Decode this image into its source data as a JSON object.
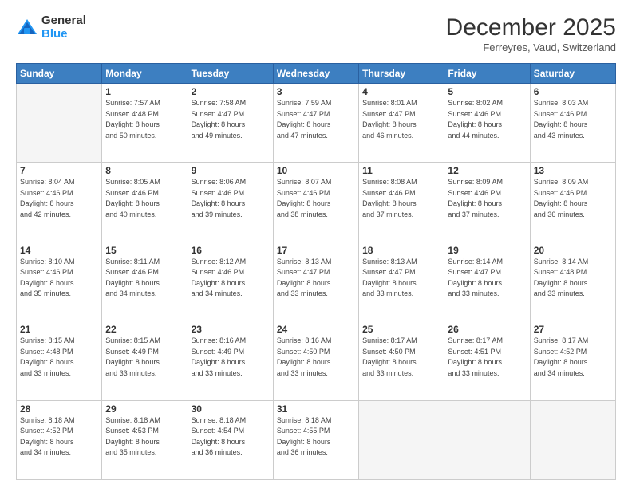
{
  "header": {
    "logo_general": "General",
    "logo_blue": "Blue",
    "month_title": "December 2025",
    "subtitle": "Ferreyres, Vaud, Switzerland"
  },
  "weekdays": [
    "Sunday",
    "Monday",
    "Tuesday",
    "Wednesday",
    "Thursday",
    "Friday",
    "Saturday"
  ],
  "weeks": [
    [
      {
        "day": "",
        "sunrise": "",
        "sunset": "",
        "daylight": ""
      },
      {
        "day": "1",
        "sunrise": "Sunrise: 7:57 AM",
        "sunset": "Sunset: 4:48 PM",
        "daylight": "Daylight: 8 hours and 50 minutes."
      },
      {
        "day": "2",
        "sunrise": "Sunrise: 7:58 AM",
        "sunset": "Sunset: 4:47 PM",
        "daylight": "Daylight: 8 hours and 49 minutes."
      },
      {
        "day": "3",
        "sunrise": "Sunrise: 7:59 AM",
        "sunset": "Sunset: 4:47 PM",
        "daylight": "Daylight: 8 hours and 47 minutes."
      },
      {
        "day": "4",
        "sunrise": "Sunrise: 8:01 AM",
        "sunset": "Sunset: 4:47 PM",
        "daylight": "Daylight: 8 hours and 46 minutes."
      },
      {
        "day": "5",
        "sunrise": "Sunrise: 8:02 AM",
        "sunset": "Sunset: 4:46 PM",
        "daylight": "Daylight: 8 hours and 44 minutes."
      },
      {
        "day": "6",
        "sunrise": "Sunrise: 8:03 AM",
        "sunset": "Sunset: 4:46 PM",
        "daylight": "Daylight: 8 hours and 43 minutes."
      }
    ],
    [
      {
        "day": "7",
        "sunrise": "Sunrise: 8:04 AM",
        "sunset": "Sunset: 4:46 PM",
        "daylight": "Daylight: 8 hours and 42 minutes."
      },
      {
        "day": "8",
        "sunrise": "Sunrise: 8:05 AM",
        "sunset": "Sunset: 4:46 PM",
        "daylight": "Daylight: 8 hours and 40 minutes."
      },
      {
        "day": "9",
        "sunrise": "Sunrise: 8:06 AM",
        "sunset": "Sunset: 4:46 PM",
        "daylight": "Daylight: 8 hours and 39 minutes."
      },
      {
        "day": "10",
        "sunrise": "Sunrise: 8:07 AM",
        "sunset": "Sunset: 4:46 PM",
        "daylight": "Daylight: 8 hours and 38 minutes."
      },
      {
        "day": "11",
        "sunrise": "Sunrise: 8:08 AM",
        "sunset": "Sunset: 4:46 PM",
        "daylight": "Daylight: 8 hours and 37 minutes."
      },
      {
        "day": "12",
        "sunrise": "Sunrise: 8:09 AM",
        "sunset": "Sunset: 4:46 PM",
        "daylight": "Daylight: 8 hours and 37 minutes."
      },
      {
        "day": "13",
        "sunrise": "Sunrise: 8:09 AM",
        "sunset": "Sunset: 4:46 PM",
        "daylight": "Daylight: 8 hours and 36 minutes."
      }
    ],
    [
      {
        "day": "14",
        "sunrise": "Sunrise: 8:10 AM",
        "sunset": "Sunset: 4:46 PM",
        "daylight": "Daylight: 8 hours and 35 minutes."
      },
      {
        "day": "15",
        "sunrise": "Sunrise: 8:11 AM",
        "sunset": "Sunset: 4:46 PM",
        "daylight": "Daylight: 8 hours and 34 minutes."
      },
      {
        "day": "16",
        "sunrise": "Sunrise: 8:12 AM",
        "sunset": "Sunset: 4:46 PM",
        "daylight": "Daylight: 8 hours and 34 minutes."
      },
      {
        "day": "17",
        "sunrise": "Sunrise: 8:13 AM",
        "sunset": "Sunset: 4:47 PM",
        "daylight": "Daylight: 8 hours and 33 minutes."
      },
      {
        "day": "18",
        "sunrise": "Sunrise: 8:13 AM",
        "sunset": "Sunset: 4:47 PM",
        "daylight": "Daylight: 8 hours and 33 minutes."
      },
      {
        "day": "19",
        "sunrise": "Sunrise: 8:14 AM",
        "sunset": "Sunset: 4:47 PM",
        "daylight": "Daylight: 8 hours and 33 minutes."
      },
      {
        "day": "20",
        "sunrise": "Sunrise: 8:14 AM",
        "sunset": "Sunset: 4:48 PM",
        "daylight": "Daylight: 8 hours and 33 minutes."
      }
    ],
    [
      {
        "day": "21",
        "sunrise": "Sunrise: 8:15 AM",
        "sunset": "Sunset: 4:48 PM",
        "daylight": "Daylight: 8 hours and 33 minutes."
      },
      {
        "day": "22",
        "sunrise": "Sunrise: 8:15 AM",
        "sunset": "Sunset: 4:49 PM",
        "daylight": "Daylight: 8 hours and 33 minutes."
      },
      {
        "day": "23",
        "sunrise": "Sunrise: 8:16 AM",
        "sunset": "Sunset: 4:49 PM",
        "daylight": "Daylight: 8 hours and 33 minutes."
      },
      {
        "day": "24",
        "sunrise": "Sunrise: 8:16 AM",
        "sunset": "Sunset: 4:50 PM",
        "daylight": "Daylight: 8 hours and 33 minutes."
      },
      {
        "day": "25",
        "sunrise": "Sunrise: 8:17 AM",
        "sunset": "Sunset: 4:50 PM",
        "daylight": "Daylight: 8 hours and 33 minutes."
      },
      {
        "day": "26",
        "sunrise": "Sunrise: 8:17 AM",
        "sunset": "Sunset: 4:51 PM",
        "daylight": "Daylight: 8 hours and 33 minutes."
      },
      {
        "day": "27",
        "sunrise": "Sunrise: 8:17 AM",
        "sunset": "Sunset: 4:52 PM",
        "daylight": "Daylight: 8 hours and 34 minutes."
      }
    ],
    [
      {
        "day": "28",
        "sunrise": "Sunrise: 8:18 AM",
        "sunset": "Sunset: 4:52 PM",
        "daylight": "Daylight: 8 hours and 34 minutes."
      },
      {
        "day": "29",
        "sunrise": "Sunrise: 8:18 AM",
        "sunset": "Sunset: 4:53 PM",
        "daylight": "Daylight: 8 hours and 35 minutes."
      },
      {
        "day": "30",
        "sunrise": "Sunrise: 8:18 AM",
        "sunset": "Sunset: 4:54 PM",
        "daylight": "Daylight: 8 hours and 36 minutes."
      },
      {
        "day": "31",
        "sunrise": "Sunrise: 8:18 AM",
        "sunset": "Sunset: 4:55 PM",
        "daylight": "Daylight: 8 hours and 36 minutes."
      },
      {
        "day": "",
        "sunrise": "",
        "sunset": "",
        "daylight": ""
      },
      {
        "day": "",
        "sunrise": "",
        "sunset": "",
        "daylight": ""
      },
      {
        "day": "",
        "sunrise": "",
        "sunset": "",
        "daylight": ""
      }
    ]
  ]
}
